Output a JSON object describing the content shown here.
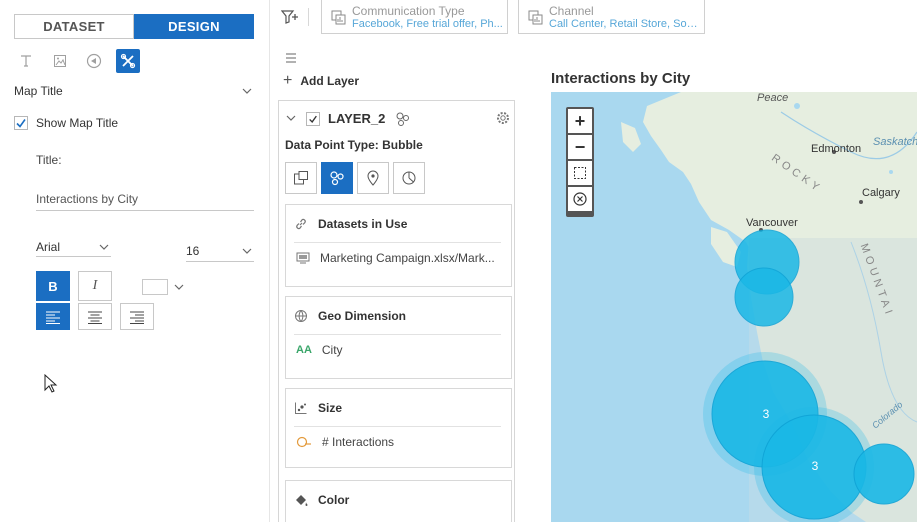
{
  "left_panel": {
    "tabs": [
      {
        "label": "DATASET",
        "active": false
      },
      {
        "label": "DESIGN",
        "active": true
      }
    ],
    "tools": [
      "text-icon",
      "image-icon",
      "shape-icon",
      "tools-icon"
    ],
    "section_label": "Map Title",
    "show_title": {
      "label": "Show Map Title",
      "checked": true
    },
    "title_label": "Title:",
    "title_value": "Interactions by City",
    "font_family": "Arial",
    "font_size": "16",
    "bold_label": "B",
    "italic_label": "I",
    "font_color": "#ffffff",
    "alignment": "left"
  },
  "filter_bar": {
    "chips": [
      {
        "title": "Communication Type",
        "value": "Facebook, Free trial offer, Ph..."
      },
      {
        "title": "Channel",
        "value": "Call Center, Retail Store, Soci..."
      }
    ]
  },
  "layer_panel": {
    "add_layer_label": "Add Layer",
    "layer_name": "LAYER_2",
    "layer_checked": true,
    "data_point_type": "Data Point Type: Bubble",
    "cards": [
      {
        "title": "Datasets in Use",
        "value": "Marketing Campaign.xlsx/Mark..."
      },
      {
        "title": "Geo Dimension",
        "value": "City"
      },
      {
        "title": "Size",
        "value": "# Interactions"
      },
      {
        "title": "Color",
        "value": ""
      }
    ]
  },
  "map": {
    "title": "Interactions by City",
    "labels": [
      "Peace",
      "Edmonton",
      "Saskatch",
      "ROCKY",
      "MOUNTAI",
      "Calgary",
      "Vancouver",
      "Colorado"
    ],
    "bubble_counts": [
      "3",
      "3"
    ],
    "bubble_color": "#1ab8e6",
    "water_color": "#a9d8ef",
    "land_color": "#e6eee0"
  },
  "colors": {
    "accent": "#1b6ec2"
  }
}
